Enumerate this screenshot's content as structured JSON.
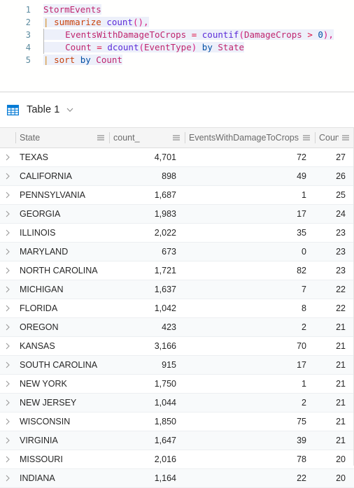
{
  "editor": {
    "lines": [
      {
        "n": "1",
        "tokens": [
          {
            "t": "StormEvents",
            "c": "tbl"
          }
        ]
      },
      {
        "n": "2",
        "tokens": [
          {
            "t": "| ",
            "c": "pipe"
          },
          {
            "t": "summarize",
            "c": "cmd"
          },
          {
            "t": " ",
            "c": "plain"
          },
          {
            "t": "count",
            "c": "fn"
          },
          {
            "t": "(),",
            "c": "punc"
          }
        ]
      },
      {
        "n": "3",
        "tokens": [
          {
            "t": "    EventsWithDamageToCrops",
            "c": "ident"
          },
          {
            "t": " = ",
            "c": "op"
          },
          {
            "t": "countif",
            "c": "fn"
          },
          {
            "t": "(",
            "c": "punc"
          },
          {
            "t": "DamageCrops",
            "c": "ident"
          },
          {
            "t": " > ",
            "c": "op"
          },
          {
            "t": "0",
            "c": "num"
          },
          {
            "t": "),",
            "c": "punc"
          }
        ]
      },
      {
        "n": "4",
        "tokens": [
          {
            "t": "    Count",
            "c": "ident"
          },
          {
            "t": " = ",
            "c": "op"
          },
          {
            "t": "dcount",
            "c": "fn"
          },
          {
            "t": "(",
            "c": "punc"
          },
          {
            "t": "EventType",
            "c": "ident"
          },
          {
            "t": ")",
            "c": "punc"
          },
          {
            "t": " ",
            "c": "plain"
          },
          {
            "t": "by",
            "c": "kw"
          },
          {
            "t": " ",
            "c": "plain"
          },
          {
            "t": "State",
            "c": "ident"
          }
        ]
      },
      {
        "n": "5",
        "tokens": [
          {
            "t": "| ",
            "c": "pipe"
          },
          {
            "t": "sort",
            "c": "cmd"
          },
          {
            "t": " ",
            "c": "plain"
          },
          {
            "t": "by",
            "c": "kw"
          },
          {
            "t": " ",
            "c": "plain"
          },
          {
            "t": "Count",
            "c": "ident"
          }
        ]
      }
    ],
    "query_text": "StormEvents | summarize count(), EventsWithDamageToCrops = countif(DamageCrops > 0), Count = dcount(EventType) by State | sort by Count"
  },
  "results": {
    "tab_label": "Table 1",
    "grid_icon": "table-grid-icon",
    "expand_icon": "chevron-down-icon",
    "column_menu_icon": "column-menu-icon",
    "row_expand_icon": "chevron-right-icon",
    "columns": [
      "State",
      "count_",
      "EventsWithDamageToCrops",
      "Count"
    ],
    "rows": [
      {
        "State": "TEXAS",
        "count_": "4,701",
        "EventsWithDamageToCrops": "72",
        "Count": "27"
      },
      {
        "State": "CALIFORNIA",
        "count_": "898",
        "EventsWithDamageToCrops": "49",
        "Count": "26"
      },
      {
        "State": "PENNSYLVANIA",
        "count_": "1,687",
        "EventsWithDamageToCrops": "1",
        "Count": "25"
      },
      {
        "State": "GEORGIA",
        "count_": "1,983",
        "EventsWithDamageToCrops": "17",
        "Count": "24"
      },
      {
        "State": "ILLINOIS",
        "count_": "2,022",
        "EventsWithDamageToCrops": "35",
        "Count": "23"
      },
      {
        "State": "MARYLAND",
        "count_": "673",
        "EventsWithDamageToCrops": "0",
        "Count": "23"
      },
      {
        "State": "NORTH CAROLINA",
        "count_": "1,721",
        "EventsWithDamageToCrops": "82",
        "Count": "23"
      },
      {
        "State": "MICHIGAN",
        "count_": "1,637",
        "EventsWithDamageToCrops": "7",
        "Count": "22"
      },
      {
        "State": "FLORIDA",
        "count_": "1,042",
        "EventsWithDamageToCrops": "8",
        "Count": "22"
      },
      {
        "State": "OREGON",
        "count_": "423",
        "EventsWithDamageToCrops": "2",
        "Count": "21"
      },
      {
        "State": "KANSAS",
        "count_": "3,166",
        "EventsWithDamageToCrops": "70",
        "Count": "21"
      },
      {
        "State": "SOUTH CAROLINA",
        "count_": "915",
        "EventsWithDamageToCrops": "17",
        "Count": "21"
      },
      {
        "State": "NEW YORK",
        "count_": "1,750",
        "EventsWithDamageToCrops": "1",
        "Count": "21"
      },
      {
        "State": "NEW JERSEY",
        "count_": "1,044",
        "EventsWithDamageToCrops": "2",
        "Count": "21"
      },
      {
        "State": "WISCONSIN",
        "count_": "1,850",
        "EventsWithDamageToCrops": "75",
        "Count": "21"
      },
      {
        "State": "VIRGINIA",
        "count_": "1,647",
        "EventsWithDamageToCrops": "39",
        "Count": "21"
      },
      {
        "State": "MISSOURI",
        "count_": "2,016",
        "EventsWithDamageToCrops": "78",
        "Count": "20"
      },
      {
        "State": "INDIANA",
        "count_": "1,164",
        "EventsWithDamageToCrops": "22",
        "Count": "20"
      }
    ]
  },
  "colors": {
    "accent": "#0078d4",
    "header_bg": "#f5f5f5",
    "row_alt_bg": "#f8fafb",
    "text": "#262626",
    "muted_text": "#6b6b6b",
    "syntax_table": "#c0266f",
    "syntax_keyword": "#0451a5",
    "syntax_function": "#5b2bd9",
    "syntax_command": "#c9430c",
    "syntax_pipe": "#d18616",
    "syntax_number": "#0451a5",
    "line_number": "#5a8a9e"
  }
}
